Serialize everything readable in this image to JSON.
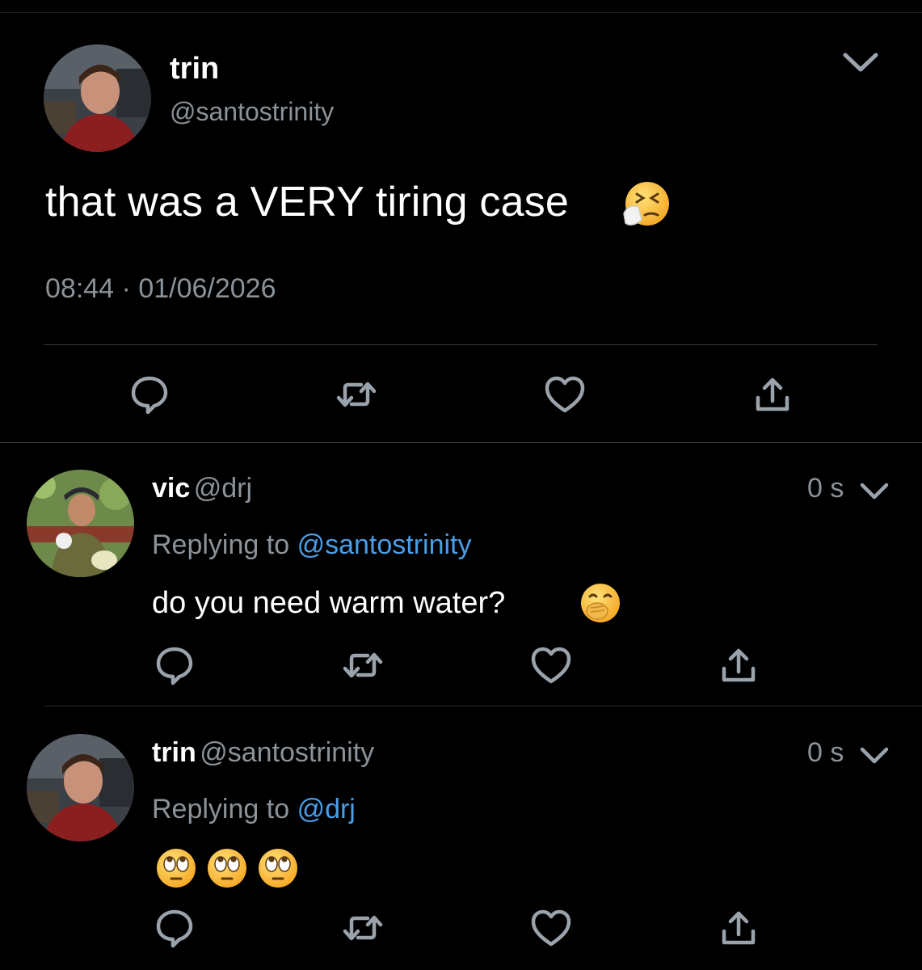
{
  "main_tweet": {
    "name": "trin",
    "handle": "@santostrinity",
    "text": "that was a VERY tiring case",
    "emoji": "sneezing-face-emoji",
    "time": "08:44",
    "separator": "·",
    "date": "01/06/2026"
  },
  "replies": [
    {
      "name": "vic",
      "handle": "@drj",
      "time": "0 s",
      "replying_prefix": "Replying to",
      "replying_to": "@santostrinity",
      "text": "do you need warm water?",
      "emoji": "hand-over-mouth-emoji"
    },
    {
      "name": "trin",
      "handle": "@santostrinity",
      "time": "0 s",
      "replying_prefix": "Replying to",
      "replying_to": "@drj",
      "text": "",
      "emoji": "face-with-rolling-eyes-emoji"
    }
  ],
  "actions": [
    "reply-icon",
    "retweet-icon",
    "like-icon",
    "share-icon"
  ],
  "colors": {
    "background": "#000000",
    "secondary_text": "#8b9298",
    "mention": "#4a9de6",
    "icon": "#9aa3ab"
  }
}
